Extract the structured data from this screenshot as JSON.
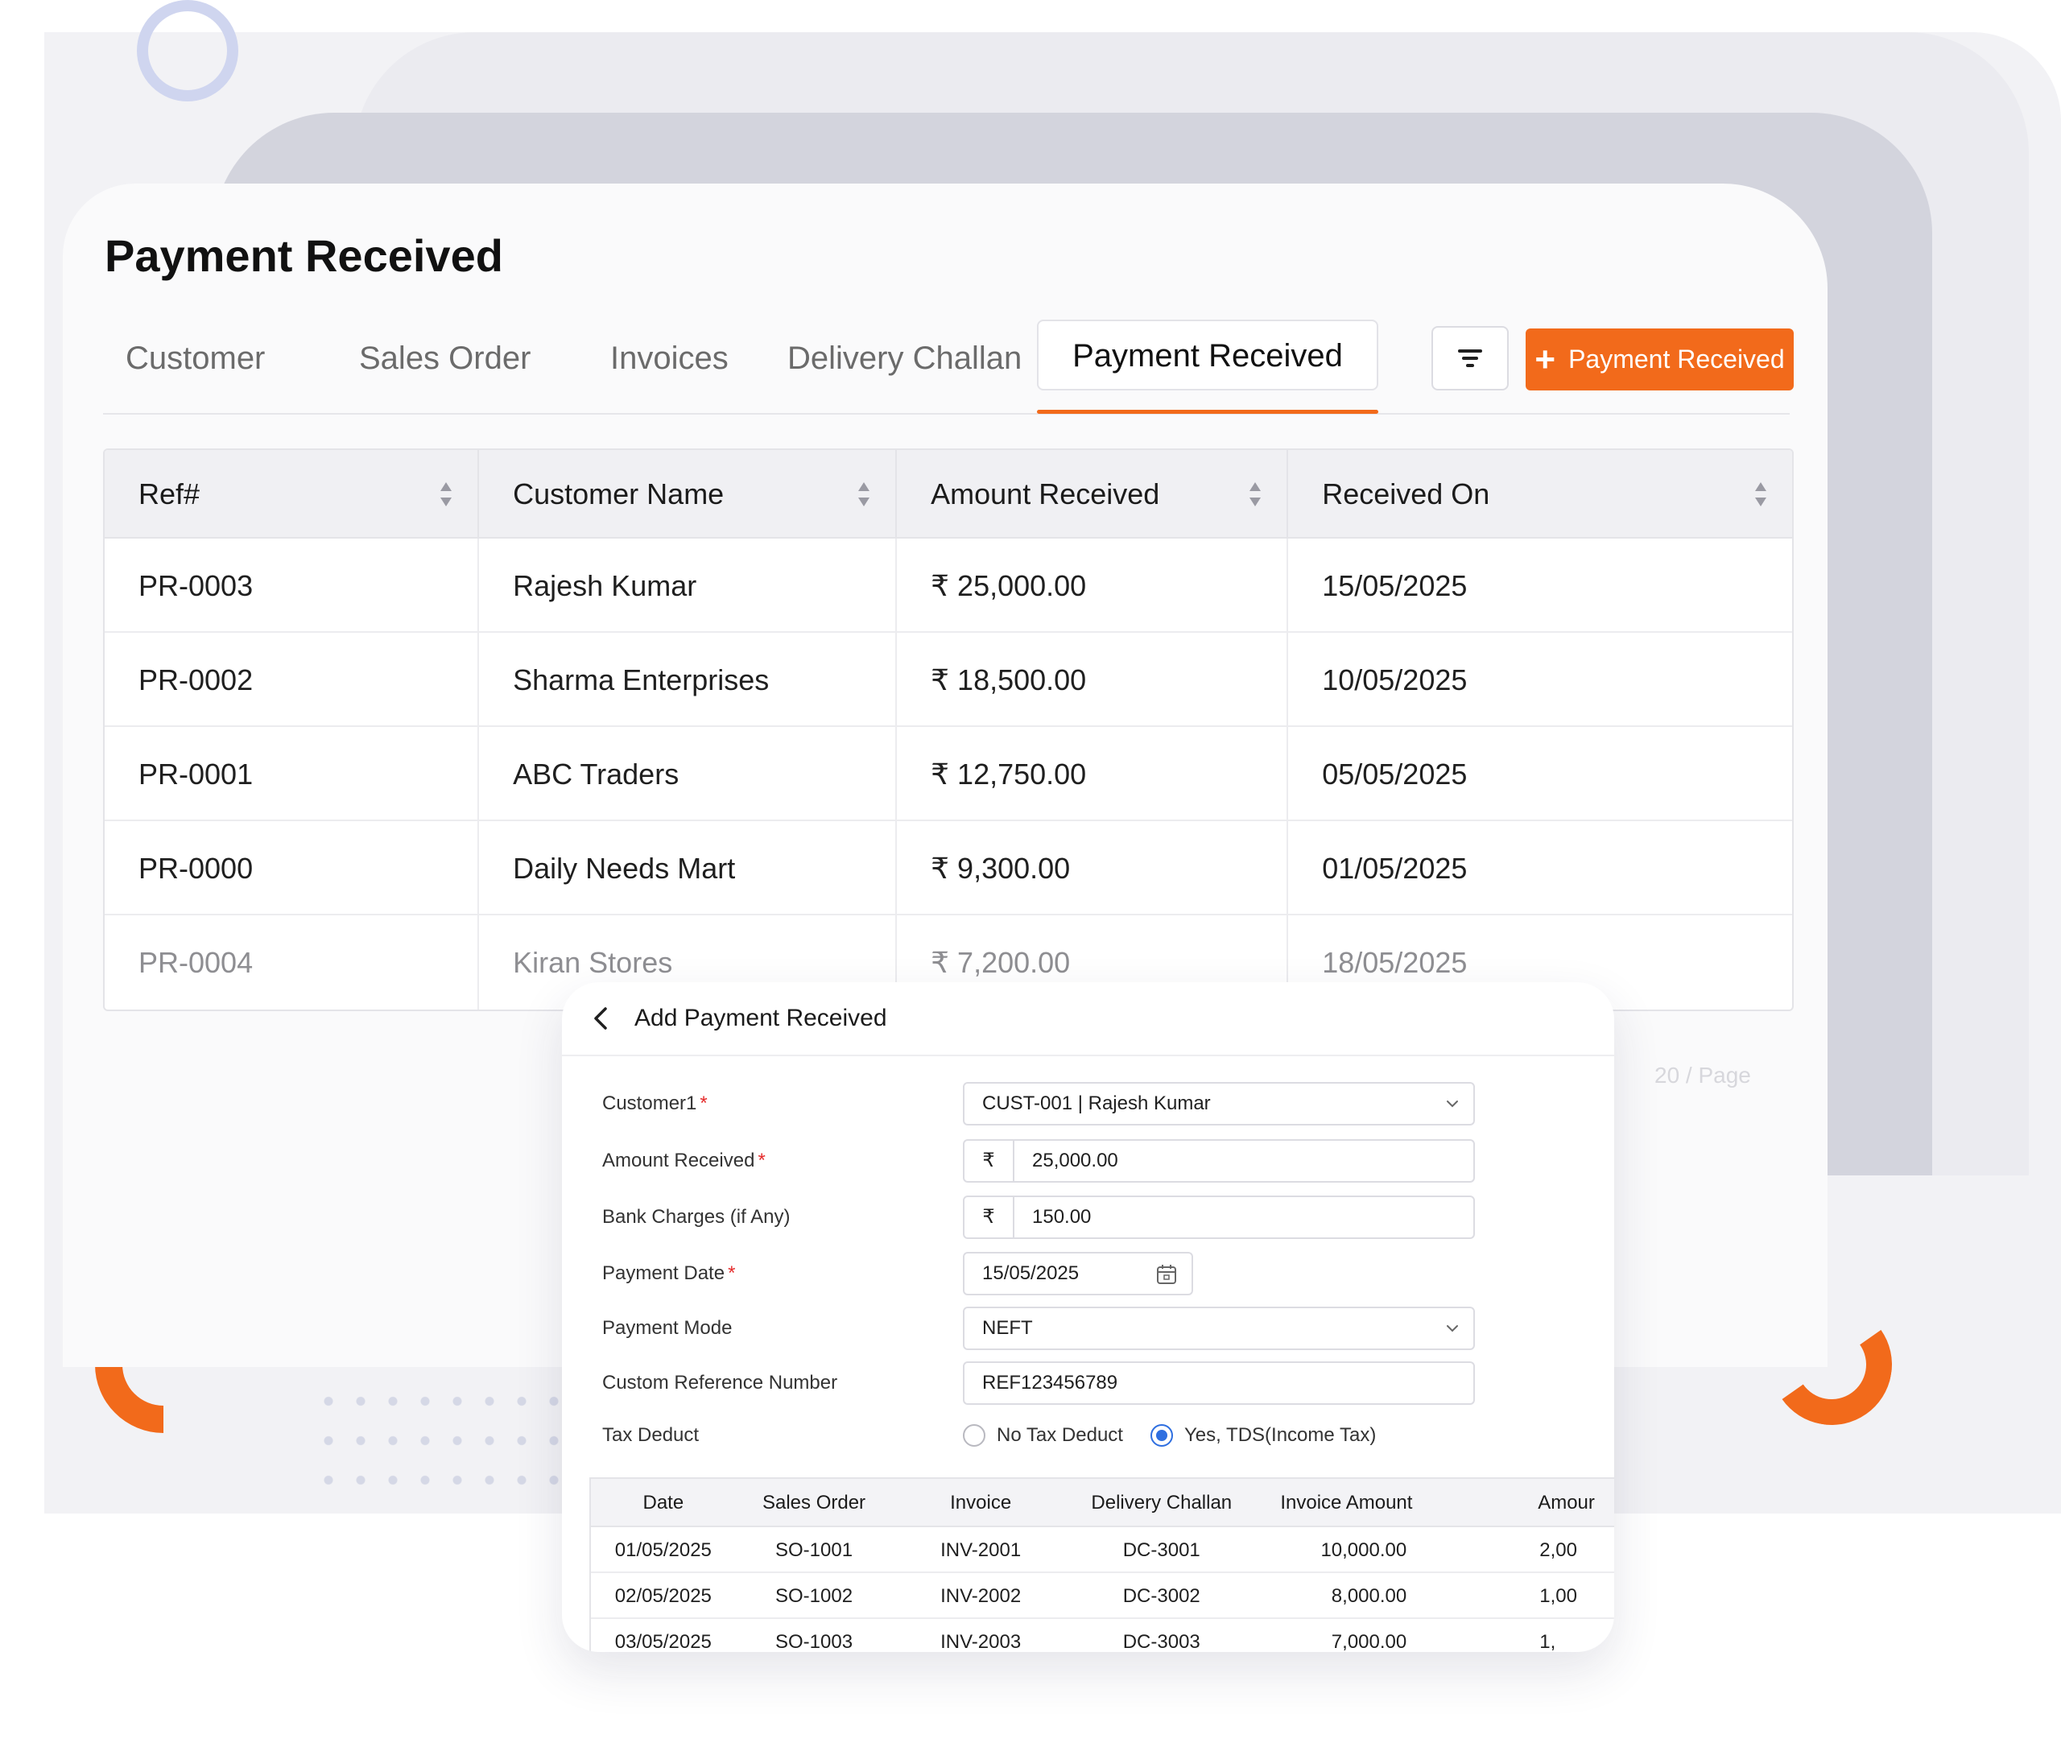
{
  "page": {
    "title": "Payment Received"
  },
  "tabs": [
    {
      "label": "Customer",
      "active": false
    },
    {
      "label": "Sales Order",
      "active": false
    },
    {
      "label": "Invoices",
      "active": false
    },
    {
      "label": "Delivery Challan",
      "active": false
    },
    {
      "label": "Payment Received",
      "active": true
    }
  ],
  "toolbar": {
    "filter_icon": "filter-icon",
    "add_label": "Payment Received",
    "add_icon": "plus-icon",
    "accent": "#f26a1b"
  },
  "table": {
    "columns": [
      "Ref#",
      "Customer Name",
      "Amount Received",
      "Received On"
    ],
    "rows": [
      {
        "ref": "PR-0003",
        "customer": "Rajesh Kumar",
        "amount": "₹ 25,000.00",
        "date": "15/05/2025"
      },
      {
        "ref": "PR-0002",
        "customer": "Sharma Enterprises",
        "amount": "₹ 18,500.00",
        "date": "10/05/2025"
      },
      {
        "ref": "PR-0001",
        "customer": "ABC Traders",
        "amount": "₹ 12,750.00",
        "date": "05/05/2025"
      },
      {
        "ref": "PR-0000",
        "customer": "Daily Needs Mart",
        "amount": "₹ 9,300.00",
        "date": "01/05/2025"
      },
      {
        "ref": "PR-0004",
        "customer": "Kiran Stores",
        "amount": "₹ 7,200.00",
        "date": "18/05/2025"
      }
    ],
    "pager": "20 / Page"
  },
  "modal": {
    "title": "Add Payment Received",
    "fields": {
      "customer": {
        "label": "Customer1",
        "value": "CUST-001 | Rajesh Kumar"
      },
      "amount": {
        "label": "Amount Received",
        "prefix": "₹",
        "value": "25,000.00"
      },
      "bank_charges": {
        "label": "Bank Charges (if Any)",
        "prefix": "₹",
        "value": "150.00"
      },
      "payment_date": {
        "label": "Payment Date",
        "value": "15/05/2025"
      },
      "payment_mode": {
        "label": "Payment Mode",
        "value": "NEFT"
      },
      "reference": {
        "label": "Custom Reference Number",
        "value": "REF123456789"
      },
      "tax": {
        "label": "Tax Deduct",
        "option_no": "No Tax Deduct",
        "option_yes": "Yes, TDS(Income Tax)",
        "selected": "yes"
      }
    },
    "required_mark": "*",
    "invoices": {
      "columns": [
        "Date",
        "Sales Order",
        "Invoice",
        "Delivery Challan",
        "Invoice Amount",
        "Amour"
      ],
      "rows": [
        [
          "01/05/2025",
          "SO-1001",
          "INV-2001",
          "DC-3001",
          "10,000.00",
          "2,00"
        ],
        [
          "02/05/2025",
          "SO-1002",
          "INV-2002",
          "DC-3002",
          "8,000.00",
          "1,00"
        ],
        [
          "03/05/2025",
          "SO-1003",
          "INV-2003",
          "DC-3003",
          "7,000.00",
          "1,"
        ]
      ]
    }
  }
}
